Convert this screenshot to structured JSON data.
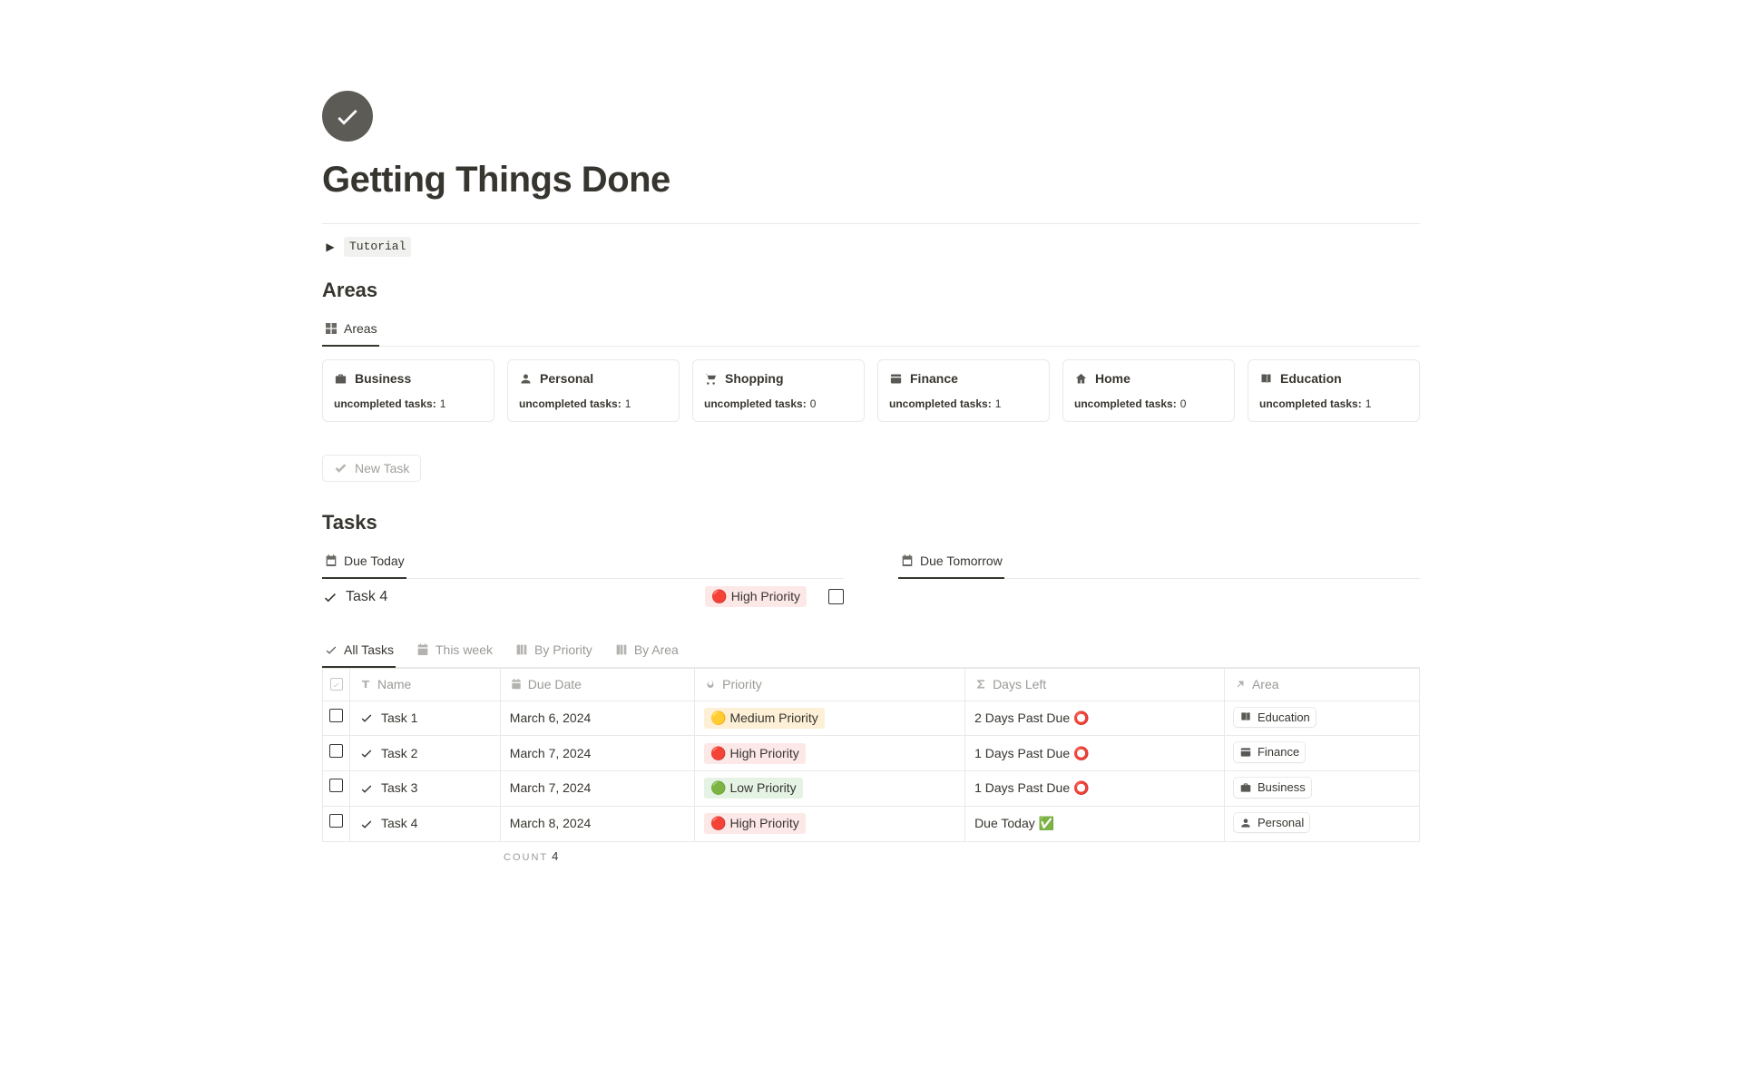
{
  "page_title": "Getting Things Done",
  "toggle": {
    "label": "Tutorial"
  },
  "areas_section": {
    "heading": "Areas",
    "tab": "Areas",
    "cards": [
      {
        "icon": "briefcase",
        "title": "Business",
        "sub_label": "uncompleted tasks:",
        "sub_value": "1"
      },
      {
        "icon": "person",
        "title": "Personal",
        "sub_label": "uncompleted tasks:",
        "sub_value": "1"
      },
      {
        "icon": "cart",
        "title": "Shopping",
        "sub_label": "uncompleted tasks:",
        "sub_value": "0"
      },
      {
        "icon": "card",
        "title": "Finance",
        "sub_label": "uncompleted tasks:",
        "sub_value": "1"
      },
      {
        "icon": "home",
        "title": "Home",
        "sub_label": "uncompleted tasks:",
        "sub_value": "0"
      },
      {
        "icon": "book",
        "title": "Education",
        "sub_label": "uncompleted tasks:",
        "sub_value": "1"
      }
    ]
  },
  "new_task_label": "New Task",
  "tasks_section": {
    "heading": "Tasks",
    "due_today_tab": "Due Today",
    "due_tomorrow_tab": "Due Tomorrow",
    "today_task": {
      "name": "Task 4",
      "priority_emoji": "🔴",
      "priority_label": "High Priority"
    },
    "tabs": [
      {
        "icon": "check",
        "label": "All Tasks",
        "active": true
      },
      {
        "icon": "cal",
        "label": "This week",
        "active": false
      },
      {
        "icon": "board",
        "label": "By Priority",
        "active": false
      },
      {
        "icon": "board",
        "label": "By Area",
        "active": false
      }
    ],
    "headers": {
      "name": "Name",
      "due_date": "Due Date",
      "priority": "Priority",
      "days_left": "Days Left",
      "area": "Area"
    },
    "rows": [
      {
        "name": "Task 1",
        "due": "March 6, 2024",
        "pri_emoji": "🟡",
        "pri_label": "Medium Priority",
        "pri_class": "pill-med",
        "days": "2 Days Past Due ⭕",
        "area_icon": "book",
        "area": "Education"
      },
      {
        "name": "Task 2",
        "due": "March 7, 2024",
        "pri_emoji": "🔴",
        "pri_label": "High Priority",
        "pri_class": "pill-high",
        "days": "1 Days Past Due ⭕",
        "area_icon": "card",
        "area": "Finance"
      },
      {
        "name": "Task 3",
        "due": "March 7, 2024",
        "pri_emoji": "🟢",
        "pri_label": "Low Priority",
        "pri_class": "pill-low",
        "days": "1 Days Past Due ⭕",
        "area_icon": "briefcase",
        "area": "Business"
      },
      {
        "name": "Task 4",
        "due": "March 8, 2024",
        "pri_emoji": "🔴",
        "pri_label": "High Priority",
        "pri_class": "pill-high",
        "days": "Due Today ✅",
        "area_icon": "person",
        "area": "Personal"
      }
    ],
    "count_label": "COUNT",
    "count_value": "4"
  }
}
